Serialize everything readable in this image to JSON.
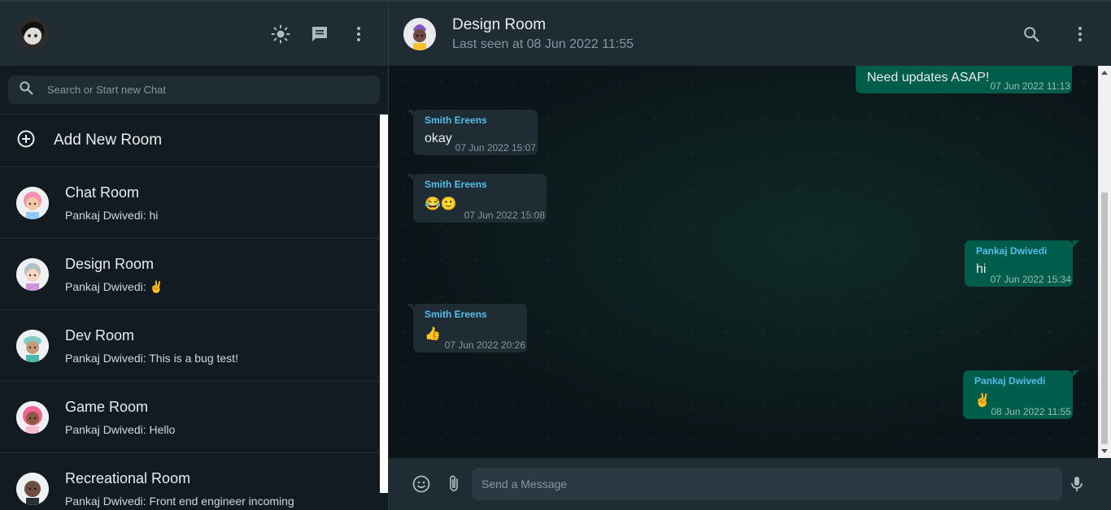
{
  "sidebar": {
    "search_placeholder": "Search or Start new Chat",
    "add_room_label": "Add New Room",
    "rooms": [
      {
        "name": "Chat Room",
        "last": "Pankaj Dwivedi: hi",
        "avatar_color": "#f48fb1"
      },
      {
        "name": "Design Room",
        "last": "Pankaj Dwivedi: ✌",
        "avatar_color": "#b0bec5"
      },
      {
        "name": "Dev Room",
        "last": "Pankaj Dwivedi: This is a bug test!",
        "avatar_color": "#80cbc4"
      },
      {
        "name": "Game Room",
        "last": "Pankaj Dwivedi: Hello",
        "avatar_color": "#f06292"
      },
      {
        "name": "Recreational Room",
        "last": "Pankaj Dwivedi: Front end engineer incoming",
        "avatar_color": "#5d4037"
      }
    ]
  },
  "chat": {
    "title": "Design Room",
    "subtitle": "Last seen at 08 Jun 2022 11:55",
    "composer_placeholder": "Send a Message",
    "messages": [
      {
        "dir": "out",
        "sender": "",
        "text": "Need updates ASAP!",
        "time": "07 Jun 2022 11:13"
      },
      {
        "dir": "in",
        "sender": "Smith Ereens",
        "text": "okay",
        "time": "07 Jun 2022 15:07"
      },
      {
        "dir": "in",
        "sender": "Smith Ereens",
        "text": "😂🙂",
        "time": "07 Jun 2022 15:08"
      },
      {
        "dir": "out",
        "sender": "Pankaj Dwivedi",
        "text": "hi",
        "time": "07 Jun 2022 15:34"
      },
      {
        "dir": "in",
        "sender": "Smith Ereens",
        "text": "👍",
        "time": "07 Jun 2022 20:26"
      },
      {
        "dir": "out",
        "sender": "Pankaj Dwivedi",
        "text": "✌",
        "time": "08 Jun 2022 11:55"
      }
    ]
  },
  "icons": {
    "theme": "brightness-icon",
    "new_chat": "chat-icon",
    "menu": "more-vert-icon",
    "search": "search-icon",
    "add": "add-circle-icon",
    "emoji": "emoji-icon",
    "attach": "attach-icon",
    "mic": "mic-icon"
  },
  "colors": {
    "outgoing_bubble": "#005c4b",
    "incoming_bubble": "#202c33",
    "sender_name": "#53bdeb"
  }
}
